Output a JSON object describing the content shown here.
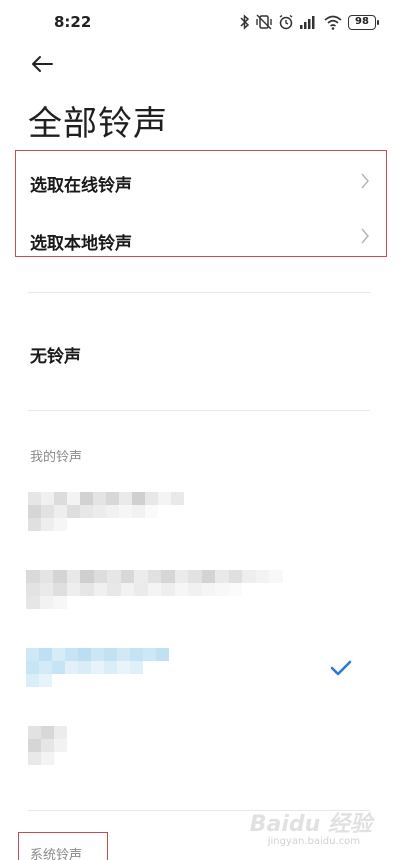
{
  "status_bar": {
    "time": "8:22",
    "battery": "98",
    "icons": [
      "bluetooth-icon",
      "vibrate-off-icon",
      "alarm-icon",
      "signal-icon",
      "wifi-icon",
      "battery-icon"
    ]
  },
  "header": {
    "back_icon": "arrow-left-icon",
    "title": "全部铃声"
  },
  "pick_options": [
    {
      "label": "选取在线铃声",
      "icon": "chevron-right-icon"
    },
    {
      "label": "选取本地铃声",
      "icon": "chevron-right-icon"
    }
  ],
  "no_ringtone": {
    "label": "无铃声"
  },
  "my_ringtones": {
    "header": "我的铃声",
    "items_note": "pixelated/blurred entries",
    "selected_icon": "checkmark-icon"
  },
  "system_ringtones": {
    "header": "系统铃声"
  },
  "watermark": {
    "text": "Baidu 经验",
    "url": "jingyan.baidu.com"
  },
  "colors": {
    "highlight_border": "#c0504d",
    "check": "#2a7ad9",
    "section_header": "#8a8a8a",
    "divider": "#e8e8e8"
  }
}
